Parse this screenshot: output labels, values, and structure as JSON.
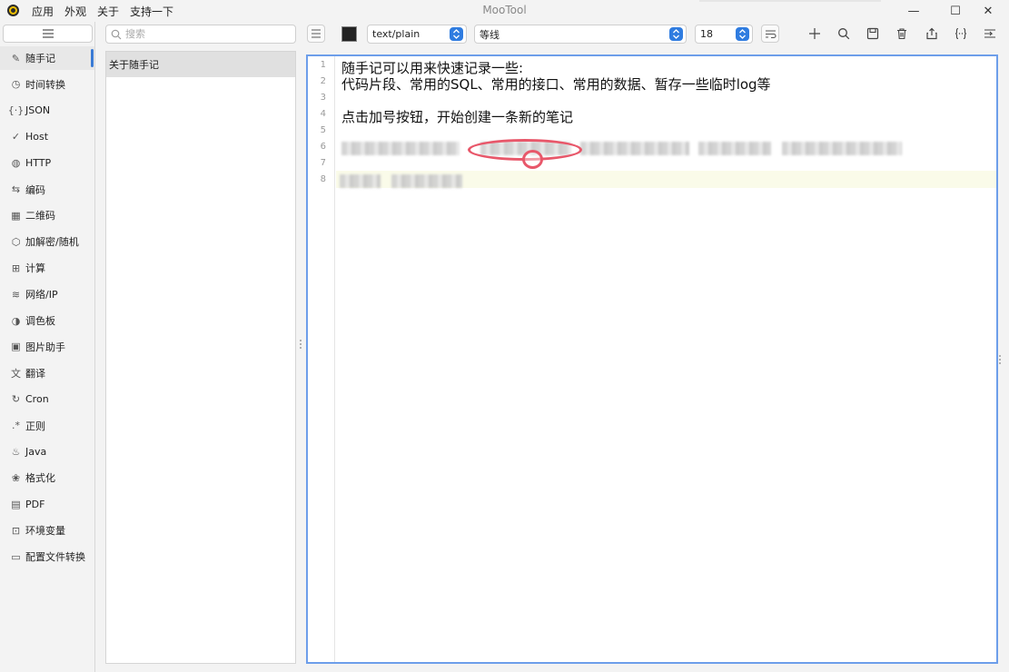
{
  "window": {
    "title": "MooTool",
    "menu": [
      "应用",
      "外观",
      "关于",
      "支持一下"
    ],
    "controls": {
      "minimize": "—",
      "maximize": "☐",
      "close": "✕"
    }
  },
  "nav": {
    "items": [
      {
        "label": "随手记",
        "icon": "pencil-icon",
        "glyph": "✎",
        "active": true
      },
      {
        "label": "时间转换",
        "icon": "clock-icon",
        "glyph": "◷"
      },
      {
        "label": "JSON",
        "icon": "braces-icon",
        "glyph": "{·}"
      },
      {
        "label": "Host",
        "icon": "check-icon",
        "glyph": "✓"
      },
      {
        "label": "HTTP",
        "icon": "globe-icon",
        "glyph": "◍"
      },
      {
        "label": "编码",
        "icon": "swap-icon",
        "glyph": "⇆"
      },
      {
        "label": "二维码",
        "icon": "qrcode-icon",
        "glyph": "▦"
      },
      {
        "label": "加解密/随机",
        "icon": "cube-icon",
        "glyph": "⬡"
      },
      {
        "label": "计算",
        "icon": "calculator-icon",
        "glyph": "⊞"
      },
      {
        "label": "网络/IP",
        "icon": "wifi-icon",
        "glyph": "≋"
      },
      {
        "label": "调色板",
        "icon": "palette-icon",
        "glyph": "◑"
      },
      {
        "label": "图片助手",
        "icon": "image-icon",
        "glyph": "▣"
      },
      {
        "label": "翻译",
        "icon": "translate-icon",
        "glyph": "文"
      },
      {
        "label": "Cron",
        "icon": "refresh-icon",
        "glyph": "↻"
      },
      {
        "label": "正则",
        "icon": "regex-icon",
        "glyph": ".*"
      },
      {
        "label": "Java",
        "icon": "java-icon",
        "glyph": "♨"
      },
      {
        "label": "格式化",
        "icon": "format-icon",
        "glyph": "❀"
      },
      {
        "label": "PDF",
        "icon": "pdf-icon",
        "glyph": "▤"
      },
      {
        "label": "环境变量",
        "icon": "env-icon",
        "glyph": "⊡"
      },
      {
        "label": "配置文件转换",
        "icon": "yml-icon",
        "glyph": "▭"
      }
    ]
  },
  "list": {
    "search_placeholder": "搜索",
    "items": [
      "关于随手记"
    ]
  },
  "toolbar": {
    "syntax": "text/plain",
    "font": "等线",
    "font_size": "18",
    "text_color": "#222222"
  },
  "editor": {
    "line_numbers": [
      "1",
      "2",
      "3",
      "4",
      "5",
      "6",
      "7",
      "8"
    ],
    "lines": [
      "随手记可以用来快速记录一些:",
      "代码片段、常用的SQL、常用的接口、常用的数据、暂存一些临时log等",
      "",
      "点击加号按钮，开始创建一条新的笔记"
    ]
  },
  "colors": {
    "accent": "#2f7ce0",
    "editor_border": "#6d9eea",
    "annotation": "#e8576a"
  }
}
